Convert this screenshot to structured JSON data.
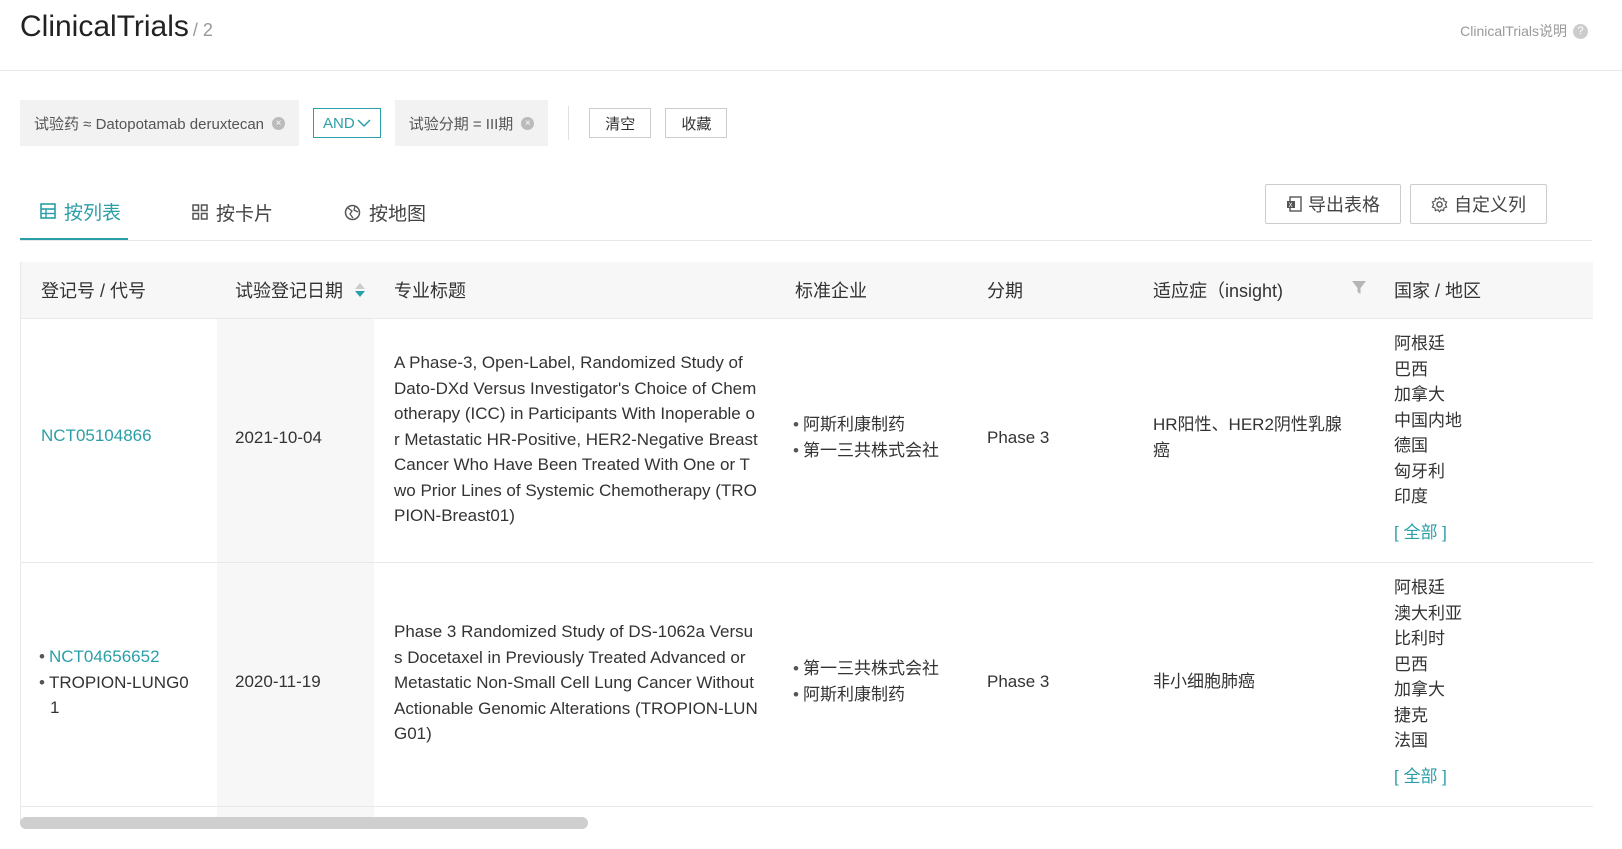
{
  "header": {
    "title": "ClinicalTrials",
    "count": "/ 2",
    "help_label": "ClinicalTrials说明",
    "help_icon": "?"
  },
  "filters": {
    "chip1": "试验药 ≈ Datopotamab deruxtecan",
    "logic": "AND",
    "chip2": "试验分期 = III期",
    "clear": "清空",
    "save": "收藏"
  },
  "tabs": {
    "list": "按列表",
    "card": "按卡片",
    "map": "按地图",
    "export": "导出表格",
    "customize": "自定义列"
  },
  "columns": {
    "id": "登记号 / 代号",
    "date": "试验登记日期",
    "title": "专业标题",
    "company": "标准企业",
    "phase": "分期",
    "indication": "适应症（insight)",
    "country": "国家 / 地区"
  },
  "rows": [
    {
      "id": "NCT05104866",
      "date": "2021-10-04",
      "title_lines": [
        "A Phase-3, Open-Label, Randomized Study of",
        "Dato-DXd Versus Investigator's Choice of Chem",
        "otherapy (ICC) in Participants With Inoperable o",
        "r Metastatic HR-Positive, HER2-Negative Breast",
        "Cancer Who Have Been Treated With One or T",
        "wo Prior Lines of Systemic Chemotherapy (TRO",
        "PION-Breast01)"
      ],
      "companies": [
        "阿斯利康制药",
        "第一三共株式会社"
      ],
      "phase": "Phase 3",
      "indication_lines": [
        "HR阳性、HER2阴性乳腺",
        "癌"
      ],
      "countries": [
        "阿根廷",
        "巴西",
        "加拿大",
        "中国内地",
        "德国",
        "匈牙利",
        "印度"
      ],
      "all_label": "[ 全部 ]"
    },
    {
      "id": "NCT04656652",
      "alias_lines": [
        "TROPION-LUNG0",
        "1"
      ],
      "date": "2020-11-19",
      "title_lines": [
        "Phase 3 Randomized Study of DS-1062a Versu",
        "s Docetaxel in Previously Treated Advanced or",
        "Metastatic Non-Small Cell Lung Cancer Without",
        "Actionable Genomic Alterations (TROPION-LUN",
        "G01)"
      ],
      "companies": [
        "第一三共株式会社",
        "阿斯利康制药"
      ],
      "phase": "Phase 3",
      "indication_lines": [
        "非小细胞肺癌"
      ],
      "countries": [
        "阿根廷",
        "澳大利亚",
        "比利时",
        "巴西",
        "加拿大",
        "捷克",
        "法国"
      ],
      "all_label": "[ 全部 ]"
    }
  ],
  "colors": {
    "accent": "#2a9fa8",
    "border": "#e8e8e8",
    "header_bg": "#f7f7f7"
  },
  "icons": [
    "close-circle-icon",
    "chevron-down-icon",
    "table-icon",
    "grid-icon",
    "globe-icon",
    "excel-export-icon",
    "gear-icon",
    "sort-icon",
    "filter-funnel-icon",
    "help-circle-icon"
  ]
}
